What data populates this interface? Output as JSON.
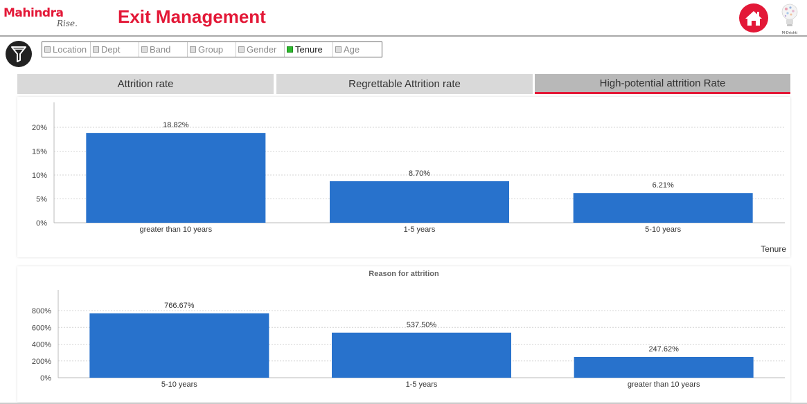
{
  "header": {
    "brand": "Mahindra",
    "brand_tagline": "Rise.",
    "title": "Exit Management",
    "home_icon": "home-icon",
    "right_logo_label": "M-Drishti",
    "accent_color": "#e31837"
  },
  "filter": {
    "icon": "funnel-icon",
    "items": [
      {
        "label": "Location",
        "selected": false
      },
      {
        "label": "Dept",
        "selected": false
      },
      {
        "label": "Band",
        "selected": false
      },
      {
        "label": "Group",
        "selected": false
      },
      {
        "label": "Gender",
        "selected": false
      },
      {
        "label": "Tenure",
        "selected": true
      },
      {
        "label": "Age",
        "selected": false
      }
    ]
  },
  "tabs": [
    {
      "label": "Attrition rate",
      "active": false
    },
    {
      "label": "Regrettable Attrition rate",
      "active": false
    },
    {
      "label": "High-potential attrition Rate",
      "active": true
    }
  ],
  "chart_data": [
    {
      "type": "bar",
      "title": "",
      "xlabel": "Tenure",
      "ylabel": "",
      "categories": [
        "greater than 10 years",
        "1-5 years",
        "5-10 years"
      ],
      "values": [
        18.82,
        8.7,
        6.21
      ],
      "data_labels": [
        "18.82%",
        "8.70%",
        "6.21%"
      ],
      "yticks": [
        "0%",
        "5%",
        "10%",
        "15%",
        "20%"
      ],
      "ylim": [
        0,
        20
      ],
      "grid": true,
      "bar_color": "#2872cc"
    },
    {
      "type": "bar",
      "title": "Reason for attrition",
      "xlabel": "",
      "ylabel": "",
      "categories": [
        "5-10 years",
        "1-5 years",
        "greater than 10 years"
      ],
      "values": [
        766.67,
        537.5,
        247.62
      ],
      "data_labels": [
        "766.67%",
        "537.50%",
        "247.62%"
      ],
      "yticks": [
        "0%",
        "200%",
        "400%",
        "600%",
        "800%"
      ],
      "ylim": [
        0,
        800
      ],
      "grid": true,
      "bar_color": "#2872cc"
    }
  ]
}
